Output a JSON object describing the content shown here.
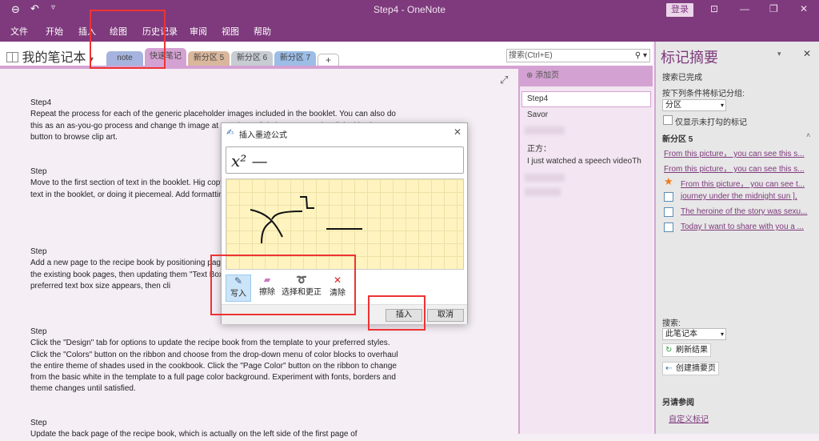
{
  "window": {
    "title": "Step4 - OneNote",
    "login": "登录"
  },
  "qat": {
    "back": "⊖",
    "undo": "↶",
    "customize": "▿"
  },
  "window_controls": {
    "ribbon_display": "⊡",
    "minimize": "—",
    "restore": "❐",
    "close": "✕"
  },
  "menu": [
    "文件",
    "开始",
    "插入",
    "绘图",
    "历史记录",
    "审阅",
    "视图",
    "帮助"
  ],
  "notebook": {
    "name": "我的笔记本",
    "dropdown": "▾"
  },
  "sections": [
    {
      "label": "note",
      "color": "#a6b3de"
    },
    {
      "label": "快速笔记",
      "color": "#d4a2d2"
    },
    {
      "label": "新分区 5",
      "color": "#dab79c"
    },
    {
      "label": "新分区 6",
      "color": "#c7ccd3"
    },
    {
      "label": "新分区 7",
      "color": "#9cbde6"
    },
    {
      "label": "+",
      "color": "#ffffff"
    }
  ],
  "search": {
    "placeholder": "搜索(Ctrl+E)",
    "icon": "⚲ ▾"
  },
  "page": {
    "expand_icon": "⤢",
    "paragraphs": [
      {
        "heading": "Step4",
        "body": "Repeat the process for each of the generic placeholder images included in the booklet. You can also do this as an as-you-go process and change th image at any time, click the \"Insert\" tab. Click eith Pictures\" button to browse clip art."
      },
      {
        "heading": "Step",
        "body": "Move to the first section of text in the booklet. Hig copy and paste from another source. You can do t the text in the booklet, or doing it piecemeal. Add formatting and layout."
      },
      {
        "heading": "Step",
        "body": "Add a new page to the recipe book by positioning page break and pressing the \"Ctrl-Enter\" keys. Add from the existing book pages, then updating them \"Text Box\" and select \"Simple Text Box\" to add a n until your preferred text box size appears, then cli"
      },
      {
        "heading": "Step",
        "body": "Click the \"Design\" tab for options to update the recipe book from the template to your preferred styles. Click the \"Colors\" button on the ribbon and choose from the drop-down menu of color blocks to overhaul the entire theme of shades used in the cookbook. Click the \"Page Color\" button on the ribbon to change from the basic white in the template to a full page color background. Experiment with fonts, borders and theme changes until satisfied."
      },
      {
        "heading": "Step",
        "body": "Update the back page of the recipe book, which is actually on the left side of the first page of"
      }
    ]
  },
  "pagelist": {
    "add_page": "添加页",
    "items": [
      "Step4",
      "Savor",
      "正方：",
      "I just watched a speech videoTh"
    ]
  },
  "dialog": {
    "title": "插入墨迹公式",
    "preview": "x² —",
    "tools": [
      {
        "label": "写入",
        "icon": "pen"
      },
      {
        "label": "擦除",
        "icon": "eraser"
      },
      {
        "label": "选择和更正",
        "icon": "lasso"
      },
      {
        "label": "清除",
        "icon": "clear"
      }
    ],
    "insert": "插入",
    "cancel": "取消",
    "close": "✕"
  },
  "tag_summary": {
    "title": "标记摘要",
    "status": "搜索已完成",
    "group_label": "按下列条件将标记分组:",
    "group_value": "分区",
    "unchecked_only": "仅显示未打勾的标记",
    "section": "新分区 5",
    "tags": [
      {
        "type": "none",
        "text": "From this picture， you can see this s..."
      },
      {
        "type": "none",
        "text": "From this picture， you can see this s..."
      },
      {
        "type": "star",
        "text": "From this picture， you can see t..."
      },
      {
        "type": "checkbox",
        "text": "journey under the midnight sun ],"
      },
      {
        "type": "checkbox",
        "text": "The heroine of the story was sexu..."
      },
      {
        "type": "checkbox",
        "text": "Today I want to share with you a ..."
      }
    ],
    "search_label": "搜索:",
    "search_value": "此笔记本",
    "refresh": "刷新结果",
    "create_summary": "创建摘要页",
    "see_also": "另请参阅",
    "custom_tags": "自定义标记"
  }
}
